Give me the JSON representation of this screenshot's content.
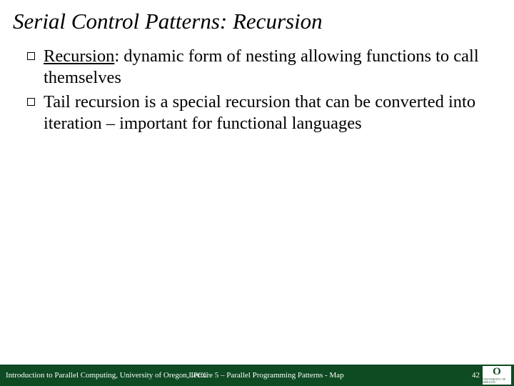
{
  "title": "Serial Control Patterns: Recursion",
  "bullets": [
    {
      "lead": "Recursion",
      "rest": ": dynamic form of nesting allowing functions to call themselves"
    },
    {
      "lead": "",
      "rest": "Tail recursion is a special recursion that can be converted into iteration – important for functional languages"
    }
  ],
  "footer": {
    "left": "Introduction to Parallel Computing, University of Oregon, IPCC",
    "center": "Lecture 5 – Parallel Programming Patterns - Map",
    "page": "42",
    "logo_main": "O",
    "logo_sub": "UNIVERSITY OF OREGON"
  }
}
